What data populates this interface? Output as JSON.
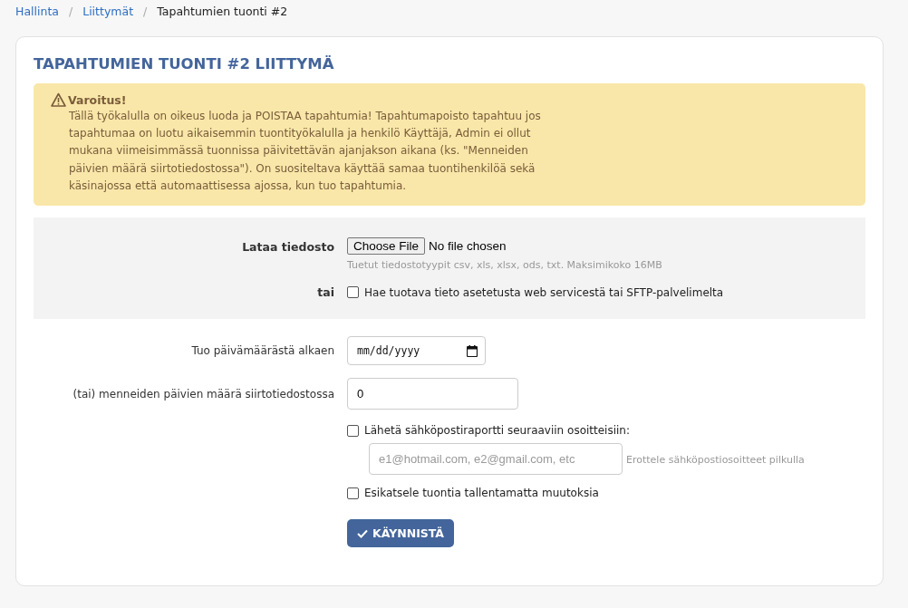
{
  "breadcrumb": [
    {
      "label": "Hallinta",
      "link": true
    },
    {
      "label": "Liittymät",
      "link": true
    },
    {
      "label": "Tapahtumien tuonti #2",
      "link": false
    }
  ],
  "breadcrumb_separator": "/",
  "title": "TAPAHTUMIEN TUONTI #2 LIITTYMÄ",
  "warning": {
    "heading": "Varoitus!",
    "text": "Tällä työkalulla on oikeus luoda ja POISTAA tapahtumia! Tapahtumapoisto tapahtuu jos tapahtumaa on luotu aikaisemmin tuontityökalulla ja henkilö Käyttäjä, Admin ei ollut mukana viimeisimmässä tuonnissa päivitettävän ajanjakson aikana (ks. \"Menneiden päivien määrä siirtotiedostossa\"). On suositeltava käyttää samaa tuontihenkilöä sekä käsinajossa että automaattisessa ajossa, kun tuo tapahtumia."
  },
  "upload": {
    "label": "Lataa tiedosto",
    "button": "Choose File",
    "status": "No file chosen",
    "hint": "Tuetut tiedostotyypit csv, xls, xlsx, ods, txt. Maksimikoko 16MB",
    "or_label": "tai",
    "fetch_option": {
      "label": "Hae tuotava tieto asetetusta web servicestä tai SFTP-palvelimelta",
      "checked": false
    }
  },
  "date_field": {
    "label": "Tuo päivämäärästä alkaen",
    "placeholder": "mm/dd/yyyy"
  },
  "days_field": {
    "label": "(tai) menneiden päivien määrä siirtotiedostossa",
    "value": "0"
  },
  "email_report": {
    "label": "Lähetä sähköpostiraportti seuraaviin osoitteisiin:",
    "checked": false,
    "placeholder": "e1@hotmail.com, e2@gmail.com, etc",
    "hint": "Erottele sähköpostiosoitteet pilkulla"
  },
  "preview_option": {
    "label": "Esikatsele tuontia tallentamatta muutoksia",
    "checked": false
  },
  "submit_button": "KÄYNNISTÄ"
}
